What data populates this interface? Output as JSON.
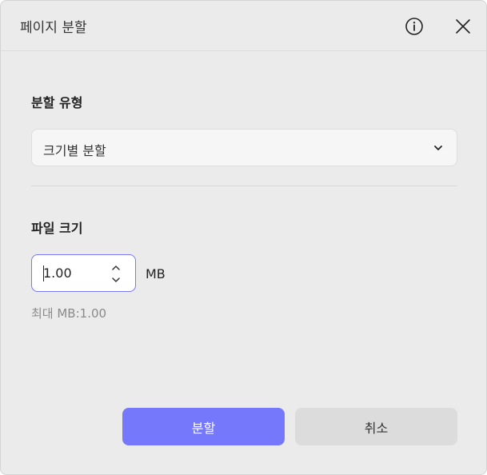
{
  "dialog": {
    "title": "페이지 분할"
  },
  "icons": {
    "info": "info-circle-icon",
    "close": "close-icon",
    "select_arrow": "chevron-down-icon",
    "step_up": "chevron-up-icon",
    "step_down": "chevron-down-icon"
  },
  "split_type": {
    "label": "분할 유형",
    "selected": "크기별 분할"
  },
  "file_size": {
    "label": "파일 크기",
    "value": "1.00",
    "unit": "MB",
    "max_text": "최대 MB:1.00"
  },
  "actions": {
    "split_label": "분할",
    "cancel_label": "취소"
  },
  "colors": {
    "accent": "#7678fb",
    "focus_border": "#7a78f4",
    "background": "#ebebeb"
  }
}
